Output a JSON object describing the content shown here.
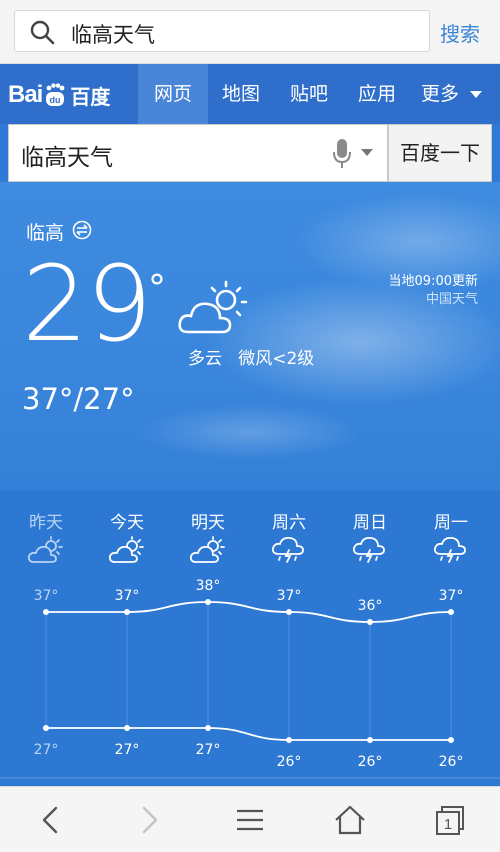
{
  "browser": {
    "search_query": "临高天气",
    "search_button": "搜索"
  },
  "baidu": {
    "logo_text": "Bai",
    "logo_text2": "du",
    "logo_cn": "百度",
    "nav": [
      "网页",
      "地图",
      "贴吧",
      "应用",
      "更多"
    ],
    "active_nav": "网页",
    "query": "临高天气",
    "submit_label": "百度一下"
  },
  "weather": {
    "city": "临高",
    "current_temp": "29",
    "degree_symbol": "°",
    "condition": "多云",
    "wind": "微风<2级",
    "range": "37°/27°",
    "update_time": "当地09:00更新",
    "source": "中国天气",
    "accent": "#2f7ad6"
  },
  "forecast": {
    "days": [
      {
        "label": "昨天",
        "icon": "partly-cloudy-icon",
        "high": "37°",
        "low": "27°",
        "past": true
      },
      {
        "label": "今天",
        "icon": "partly-cloudy-icon",
        "high": "37°",
        "low": "27°",
        "past": false
      },
      {
        "label": "明天",
        "icon": "partly-cloudy-icon",
        "high": "38°",
        "low": "27°",
        "past": false
      },
      {
        "label": "周六",
        "icon": "thunderstorm-icon",
        "high": "37°",
        "low": "26°",
        "past": false
      },
      {
        "label": "周日",
        "icon": "thunderstorm-icon",
        "high": "36°",
        "low": "26°",
        "past": false
      },
      {
        "label": "周一",
        "icon": "thunderstorm-icon",
        "high": "37°",
        "low": "26°",
        "past": false
      }
    ]
  },
  "chart_data": {
    "type": "line",
    "categories": [
      "昨天",
      "今天",
      "明天",
      "周六",
      "周日",
      "周一"
    ],
    "series": [
      {
        "values": [
          37,
          37,
          38,
          37,
          36,
          37
        ]
      },
      {
        "values": [
          27,
          27,
          27,
          26,
          26,
          26
        ]
      }
    ]
  },
  "toolbar": {
    "icons": [
      "back-icon",
      "forward-icon",
      "menu-icon",
      "home-icon",
      "tabs-icon"
    ],
    "tab_count": "1"
  }
}
